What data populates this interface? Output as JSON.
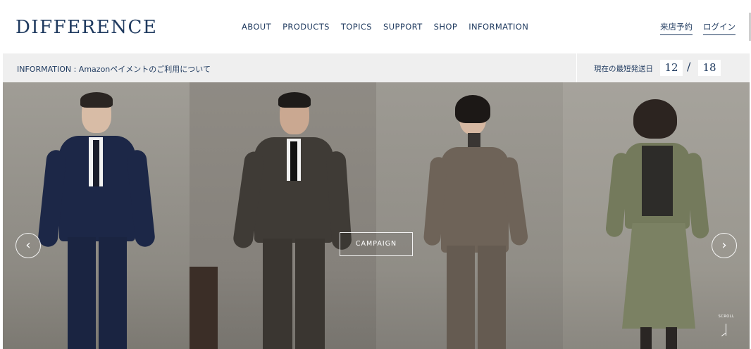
{
  "header": {
    "logo": "DIFFERENCE",
    "nav": [
      "ABOUT",
      "PRODUCTS",
      "TOPICS",
      "SUPPORT",
      "SHOP",
      "INFORMATION"
    ],
    "util": [
      "来店予約",
      "ログイン"
    ]
  },
  "infobar": {
    "text": "INFORMATION : Amazonペイメントのご利用について",
    "ship_label": "現在の最短発送日",
    "ship_month": "12",
    "ship_slash": "/",
    "ship_day": "18"
  },
  "hero": {
    "campaign_label": "CAMPAIGN",
    "prev_icon": "‹",
    "next_icon": "›",
    "scroll_label": "SCROLL"
  }
}
